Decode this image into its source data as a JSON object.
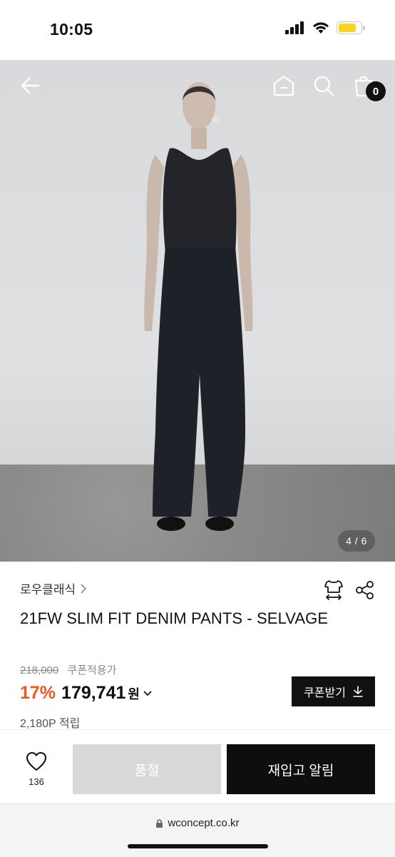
{
  "status_bar": {
    "time": "10:05",
    "battery_level": 0.8,
    "battery_color": "#ffd21f"
  },
  "hero": {
    "image_counter": "4 / 6",
    "cart_count": "0",
    "icons": [
      "back-arrow-icon",
      "home-icon",
      "search-icon",
      "shopping-bag-icon"
    ]
  },
  "product": {
    "brand": "로우클래식",
    "title": "21FW SLIM FIT DENIM PANTS - SELVAGE",
    "original_price": "218,000",
    "coupon_note": "쿠폰적용가",
    "discount": "17%",
    "price": "179,741",
    "currency": "원",
    "points": "2,180P 적립",
    "coupon_button": "쿠폰받기"
  },
  "bottom_bar": {
    "like_count": "136",
    "soldout_label": "품절",
    "restock_label": "재입고 알림"
  },
  "browser": {
    "url": "wconcept.co.kr"
  },
  "colors": {
    "accent_discount": "#f2551f",
    "primary_button": "#0e0e0e",
    "disabled_button": "#d9d9d9"
  }
}
